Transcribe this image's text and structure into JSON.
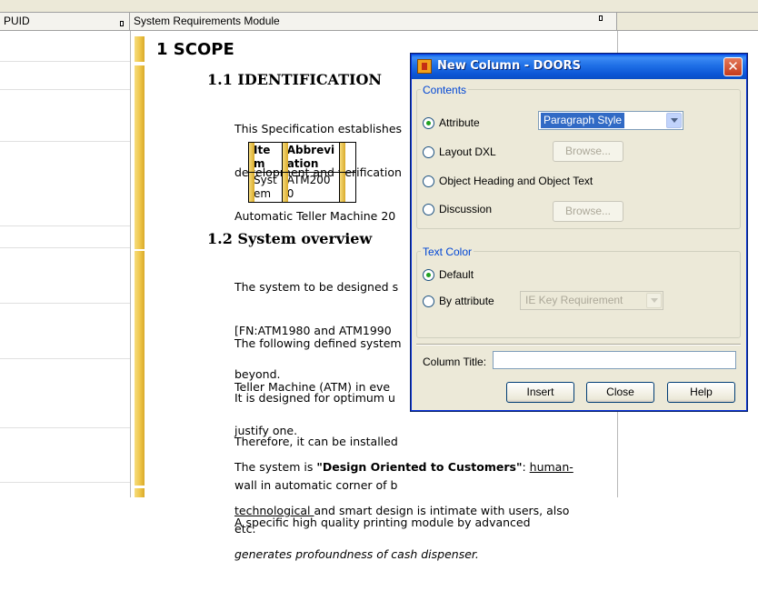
{
  "columns": {
    "puid_header": "PUID",
    "module_header": "System Requirements Module"
  },
  "content": {
    "h1": "1 SCOPE",
    "h1_1": "1.1 IDENTIFICATION",
    "p_ident": [
      "This Specification establishes",
      "development and verification",
      "Automatic Teller Machine 20"
    ],
    "table": {
      "headers": [
        "Ite\nm",
        "Abbrevi\nation"
      ],
      "row": [
        "Syst\nem",
        "ATM200\n0"
      ]
    },
    "h1_2": "1.2 System overview",
    "p1": [
      "The system to be designed s",
      "[FN:ATM1980 and ATM1990",
      "beyond."
    ],
    "p2": [
      "The following defined system",
      "Teller Machine (ATM) in eve",
      "justify one."
    ],
    "p3": [
      "It is designed for optimum u",
      "Therefore, it can be installed",
      "wall in automatic corner of b",
      "etc."
    ],
    "p4": {
      "l1_a": "The system is ",
      "l1_b": "\"Design Oriented to Customers\"",
      "l1_c": ": ",
      "l1_d": "human-",
      "l2_a": "technological ",
      "l2_b": "and smart design is intimate with users, also",
      "l3": "generates profoundness of cash dispenser."
    },
    "p5": "A specific high quality printing module by advanced"
  },
  "dialog": {
    "title": "New Column - DOORS",
    "contents_group": "Contents",
    "attribute_label": "Attribute",
    "attribute_value": "Paragraph Style",
    "layout_dxl_label": "Layout DXL",
    "browse_label": "Browse...",
    "object_heading_label": "Object Heading and Object Text",
    "discussion_label": "Discussion",
    "browse2_label": "Browse...",
    "text_color_group": "Text Color",
    "default_label": "Default",
    "by_attribute_label": "By attribute",
    "by_attribute_value": "IE Key Requirement",
    "column_title_label": "Column Title:",
    "column_title_value": "",
    "insert_label": "Insert",
    "close_label": "Close",
    "help_label": "Help",
    "selected_contents": "Attribute",
    "selected_text_color": "Default"
  }
}
